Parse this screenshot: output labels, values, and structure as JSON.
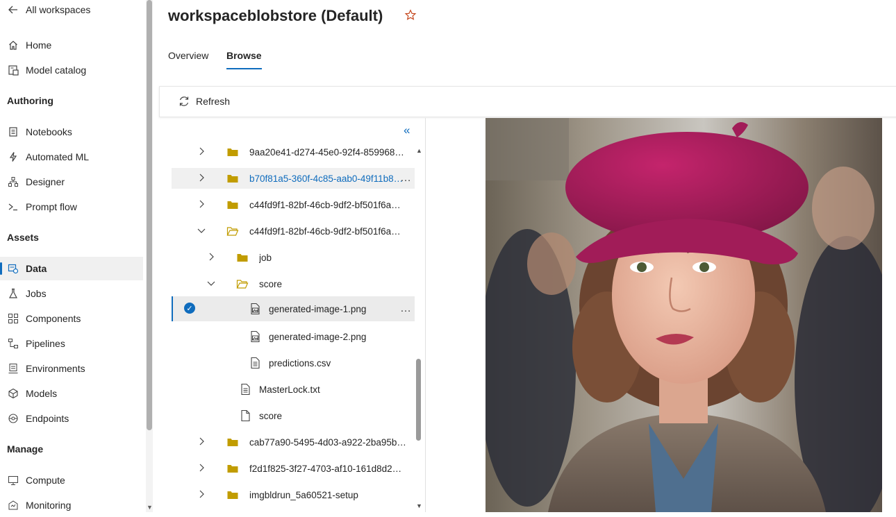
{
  "nav": {
    "back_label": "All workspaces",
    "items_top": [
      {
        "label": "Home",
        "icon": "home-icon"
      },
      {
        "label": "Model catalog",
        "icon": "catalog-icon"
      }
    ],
    "sections": [
      {
        "title": "Authoring",
        "items": [
          {
            "label": "Notebooks",
            "icon": "notebook-icon"
          },
          {
            "label": "Automated ML",
            "icon": "automl-icon"
          },
          {
            "label": "Designer",
            "icon": "designer-icon"
          },
          {
            "label": "Prompt flow",
            "icon": "prompt-flow-icon"
          }
        ]
      },
      {
        "title": "Assets",
        "items": [
          {
            "label": "Data",
            "icon": "data-icon",
            "active": true
          },
          {
            "label": "Jobs",
            "icon": "jobs-icon"
          },
          {
            "label": "Components",
            "icon": "components-icon"
          },
          {
            "label": "Pipelines",
            "icon": "pipelines-icon"
          },
          {
            "label": "Environments",
            "icon": "environments-icon"
          },
          {
            "label": "Models",
            "icon": "models-icon"
          },
          {
            "label": "Endpoints",
            "icon": "endpoints-icon"
          }
        ]
      },
      {
        "title": "Manage",
        "items": [
          {
            "label": "Compute",
            "icon": "compute-icon"
          },
          {
            "label": "Monitoring",
            "icon": "monitoring-icon"
          }
        ]
      }
    ]
  },
  "header": {
    "title": "workspaceblobstore (Default)",
    "tabs": [
      {
        "label": "Overview",
        "active": false
      },
      {
        "label": "Browse",
        "active": true
      }
    ]
  },
  "toolbar": {
    "refresh_label": "Refresh"
  },
  "tree": {
    "rows": [
      {
        "label": "9aa20e41-d274-45e0-92f4-859968…",
        "type": "folder",
        "depth": 0,
        "expanded": false
      },
      {
        "label": "b70f81a5-360f-4c85-aab0-49f11b8…",
        "type": "folder",
        "depth": 0,
        "expanded": false,
        "hover": true,
        "link": true
      },
      {
        "label": "c44fd9f1-82bf-46cb-9df2-bf501f6a…",
        "type": "folder",
        "depth": 0,
        "expanded": false
      },
      {
        "label": "c44fd9f1-82bf-46cb-9df2-bf501f6a…",
        "type": "folder-open",
        "depth": 0,
        "expanded": true
      },
      {
        "label": "job",
        "type": "folder",
        "depth": 1,
        "expanded": false
      },
      {
        "label": "score",
        "type": "folder-open",
        "depth": 1,
        "expanded": true
      },
      {
        "label": "generated-image-1.png",
        "type": "image",
        "depth": 2,
        "selected": true
      },
      {
        "label": "generated-image-2.png",
        "type": "image",
        "depth": 2
      },
      {
        "label": "predictions.csv",
        "type": "file",
        "depth": 2
      },
      {
        "label": "MasterLock.txt",
        "type": "file",
        "depth": 1
      },
      {
        "label": "score",
        "type": "blank-file",
        "depth": 1
      },
      {
        "label": "cab77a90-5495-4d03-a922-2ba95b…",
        "type": "folder",
        "depth": 0,
        "expanded": false
      },
      {
        "label": "f2d1f825-3f27-4703-af10-161d8d2…",
        "type": "folder",
        "depth": 0,
        "expanded": false
      },
      {
        "label": "imgbldrun_5a60521-setup",
        "type": "folder",
        "depth": 0,
        "expanded": false
      }
    ],
    "more_label": "…"
  },
  "colors": {
    "accent": "#0f6cbd",
    "folder": "#c19c00",
    "star": "#c4441a"
  }
}
